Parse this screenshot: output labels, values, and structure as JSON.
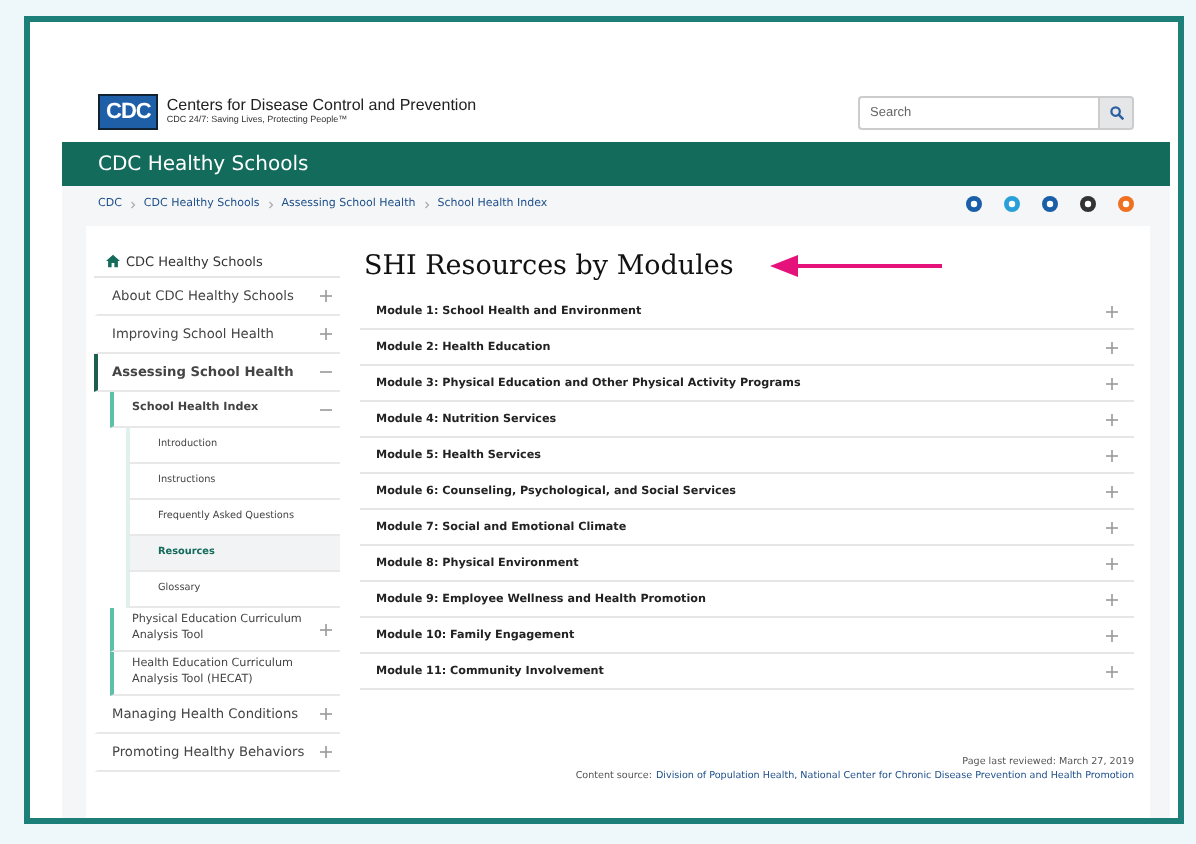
{
  "header": {
    "logo": "CDC",
    "org_name": "Centers for Disease Control and Prevention",
    "tagline": "CDC 24/7: Saving Lives, Protecting People™",
    "search": {
      "placeholder": "Search"
    }
  },
  "site_bar": {
    "title": "CDC Healthy Schools"
  },
  "breadcrumb": [
    "CDC",
    "CDC Healthy Schools",
    "Assessing School Health",
    "School Health Index"
  ],
  "sidebar": {
    "home": "CDC Healthy Schools",
    "items": [
      {
        "label": "About CDC Healthy Schools",
        "expanded": false,
        "selected": false
      },
      {
        "label": "Improving School Health",
        "expanded": false,
        "selected": false
      },
      {
        "label": "Assessing School Health",
        "expanded": true,
        "selected": false,
        "children": [
          {
            "label": "School Health Index",
            "expanded": true,
            "selected": false,
            "children": [
              {
                "label": "Introduction",
                "selected": false
              },
              {
                "label": "Instructions",
                "selected": false
              },
              {
                "label": "Frequently Asked Questions",
                "selected": false
              },
              {
                "label": "Resources",
                "selected": true
              },
              {
                "label": "Glossary",
                "selected": false
              }
            ]
          },
          {
            "label": "Physical Education Curriculum Analysis Tool",
            "expanded": false,
            "selected": false
          },
          {
            "label": "Health Education Curriculum Analysis Tool (HECAT)",
            "selected": false
          }
        ]
      },
      {
        "label": "Managing Health Conditions",
        "expanded": false,
        "selected": false
      },
      {
        "label": "Promoting Healthy Behaviors",
        "expanded": false,
        "selected": false
      }
    ]
  },
  "main": {
    "title": "SHI Resources by Modules",
    "modules": [
      {
        "label": "Module 1: School Health and Environment",
        "expanded": false
      },
      {
        "label": "Module 2: Health Education",
        "expanded": false
      },
      {
        "label": "Module 3: Physical Education and Other Physical Activity Programs",
        "expanded": false
      },
      {
        "label": "Module 4: Nutrition Services",
        "expanded": false
      },
      {
        "label": "Module 5: Health Services",
        "expanded": false
      },
      {
        "label": "Module 6: Counseling, Psychological, and Social Services",
        "expanded": false
      },
      {
        "label": "Module 7: Social and Emotional Climate",
        "expanded": false
      },
      {
        "label": "Module 8: Physical Environment",
        "expanded": false
      },
      {
        "label": "Module 9: Employee Wellness and Health Promotion",
        "expanded": false
      },
      {
        "label": "Module 10: Family Engagement",
        "expanded": false
      },
      {
        "label": "Module 11: Community Involvement",
        "expanded": false
      }
    ]
  },
  "footer": {
    "reviewed": "Page last reviewed: March 27, 2019",
    "source_label": "Content source:",
    "source_link": "Division of Population Health, National Center for Chronic Disease Prevention and Health Promotion"
  }
}
